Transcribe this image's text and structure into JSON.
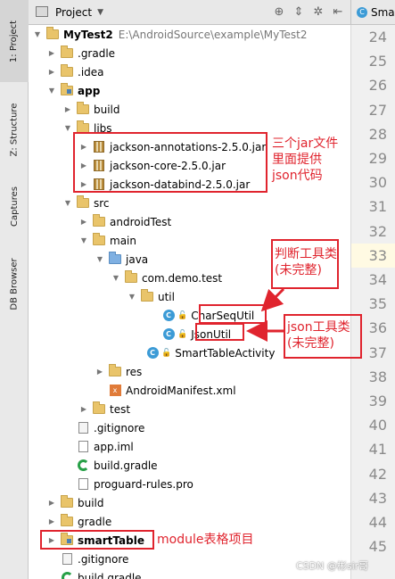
{
  "sidebar": {
    "tabs": [
      "1: Project",
      "Z: Structure",
      "Captures",
      "DB Browser"
    ]
  },
  "panel": {
    "title": "Project",
    "chevron": "▼",
    "icons": [
      "sync-icon",
      "collapse-icon",
      "settings-icon",
      "hide-icon"
    ],
    "icon_glyphs": [
      "⊕",
      "⇕",
      "✲",
      "⇤"
    ]
  },
  "editor": {
    "tab_label": "Sma",
    "line_numbers": [
      "24",
      "25",
      "26",
      "27",
      "28",
      "29",
      "30",
      "31",
      "32",
      "33",
      "34",
      "35",
      "36",
      "37",
      "38",
      "39",
      "40",
      "41",
      "42",
      "43",
      "44",
      "45"
    ],
    "current_line": "33"
  },
  "tree": {
    "root_name": "MyTest2",
    "root_path": "E:\\AndroidSource\\example\\MyTest2",
    "gradle_dir": ".gradle",
    "idea_dir": ".idea",
    "app": "app",
    "build": "build",
    "libs": "libs",
    "jars": [
      "jackson-annotations-2.5.0.jar",
      "jackson-core-2.5.0.jar",
      "jackson-databind-2.5.0.jar"
    ],
    "src": "src",
    "android_test": "androidTest",
    "main": "main",
    "java": "java",
    "package": "com.demo.test",
    "util": "util",
    "char_seq_util": "CharSeqUtil",
    "json_util": "JsonUtil",
    "activity": "SmartTableActivity",
    "res": "res",
    "manifest": "AndroidManifest.xml",
    "test": "test",
    "app_gitignore": ".gitignore",
    "app_iml": "app.iml",
    "app_build_gradle": "build.gradle",
    "proguard": "proguard-rules.pro",
    "root_build": "build",
    "root_gradle": "gradle",
    "smart_table": "smartTable",
    "root_gitignore": ".gitignore",
    "root_build_gradle": "build.gradle",
    "class_badge": "C",
    "lock_glyph": "🔓"
  },
  "annotations": {
    "jar_note_lines": [
      "三个jar文件",
      "里面提供",
      "json代码"
    ],
    "judge_note_lines": [
      "判断工具类",
      "(未完整)"
    ],
    "json_note_lines": [
      "json工具类",
      "(未完整)"
    ],
    "module_note": "module表格项目"
  },
  "watermark": "CSDN @彬sir哥",
  "colors": {
    "annotation": "#e0242e",
    "class_icon": "#3c9bd6",
    "folder": "#e9c46a",
    "source_folder": "#7fb0e2"
  }
}
